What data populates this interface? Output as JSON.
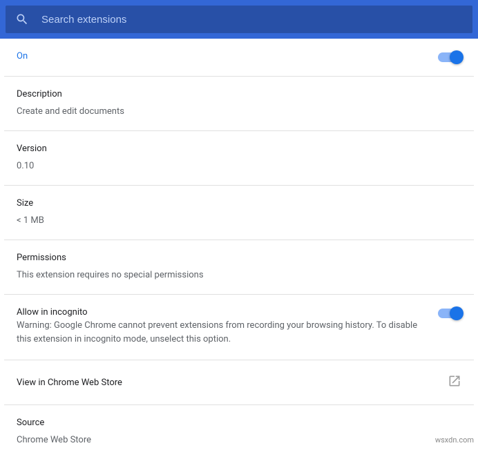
{
  "search": {
    "placeholder": "Search extensions"
  },
  "status": {
    "label": "On"
  },
  "description": {
    "label": "Description",
    "value": "Create and edit documents"
  },
  "version": {
    "label": "Version",
    "value": "0.10"
  },
  "size": {
    "label": "Size",
    "value": "< 1 MB"
  },
  "permissions": {
    "label": "Permissions",
    "value": "This extension requires no special permissions"
  },
  "incognito": {
    "label": "Allow in incognito",
    "warning": "Warning: Google Chrome cannot prevent extensions from recording your browsing history. To disable this extension in incognito mode, unselect this option."
  },
  "webstore_link": {
    "label": "View in Chrome Web Store"
  },
  "source": {
    "label": "Source",
    "value": "Chrome Web Store"
  },
  "watermark": "wsxdn.com"
}
